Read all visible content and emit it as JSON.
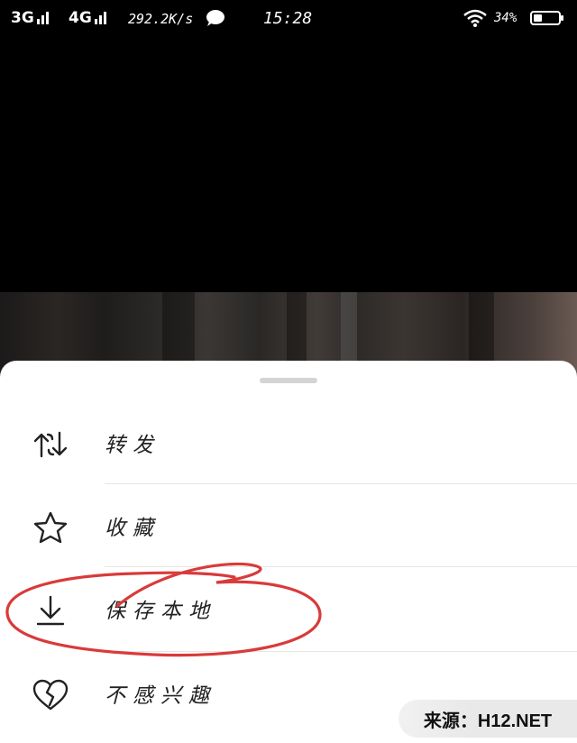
{
  "status_bar": {
    "network1": "3G",
    "network2": "4G",
    "speed": "292.2K/s",
    "time": "15:28",
    "battery_percent": "34%",
    "battery_level": 0.34,
    "icons": [
      "signal-icon",
      "message-bubble-icon",
      "wifi-icon",
      "battery-icon"
    ]
  },
  "sheet": {
    "items": [
      {
        "label": "转发",
        "icon": "repost-icon"
      },
      {
        "label": "收藏",
        "icon": "star-icon"
      },
      {
        "label": "保存本地",
        "icon": "download-icon"
      },
      {
        "label": "不感兴趣",
        "icon": "broken-heart-icon"
      }
    ]
  },
  "annotation_color": "#d93a3a",
  "watermark": "来源：H12.NET"
}
